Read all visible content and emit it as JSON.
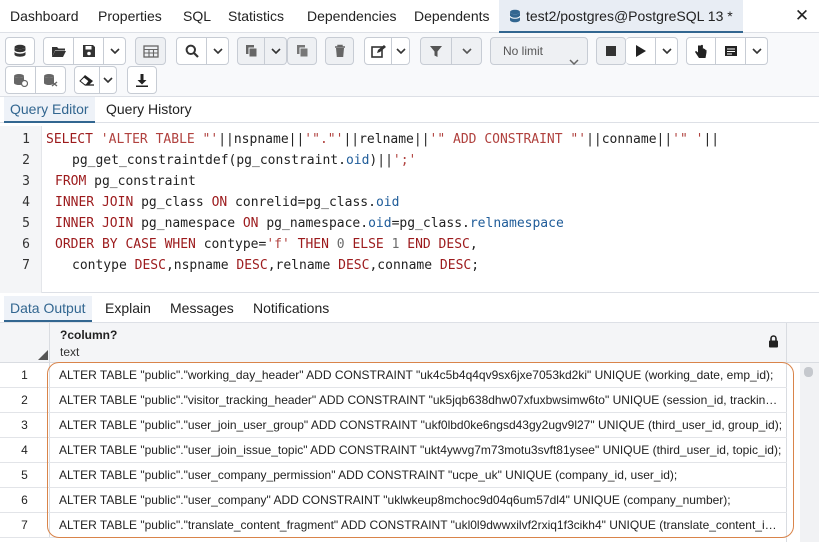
{
  "main_tabs": [
    {
      "label": "Dashboard"
    },
    {
      "label": "Properties"
    },
    {
      "label": "SQL"
    },
    {
      "label": "Statistics"
    },
    {
      "label": "Dependencies"
    },
    {
      "label": "Dependents"
    },
    {
      "label": "test2/postgres@PostgreSQL 13 *"
    }
  ],
  "close_glyph": "✕",
  "toolbar": {
    "limit_label": "No limit"
  },
  "editor_tabs": [
    {
      "label": "Query Editor"
    },
    {
      "label": "Query History"
    }
  ],
  "editor": {
    "line_numbers": [
      "1",
      "2",
      "3",
      "4",
      "5",
      "6",
      "7"
    ]
  },
  "output_tabs": [
    {
      "label": "Data Output"
    },
    {
      "label": "Explain"
    },
    {
      "label": "Messages"
    },
    {
      "label": "Notifications"
    }
  ],
  "grid": {
    "column": {
      "name": "?column?",
      "type": "text"
    },
    "rows": [
      {
        "num": "1",
        "value": "ALTER TABLE \"public\".\"working_day_header\" ADD CONSTRAINT \"uk4c5b4q4qv9sx6jxe7053kd2ki\" UNIQUE (working_date, emp_id);"
      },
      {
        "num": "2",
        "value": "ALTER TABLE \"public\".\"visitor_tracking_header\" ADD CONSTRAINT \"uk5jqb638dhw07xfuxbwsimw6to\" UNIQUE (session_id, tracking_da..."
      },
      {
        "num": "3",
        "value": "ALTER TABLE \"public\".\"user_join_user_group\" ADD CONSTRAINT \"ukf0lbd0ke6ngsd43gy2ugv9l27\" UNIQUE (third_user_id, group_id);"
      },
      {
        "num": "4",
        "value": "ALTER TABLE \"public\".\"user_join_issue_topic\" ADD CONSTRAINT \"ukt4ywvg7m73motu3svft81ysee\" UNIQUE (third_user_id, topic_id);"
      },
      {
        "num": "5",
        "value": "ALTER TABLE \"public\".\"user_company_permission\" ADD CONSTRAINT \"ucpe_uk\" UNIQUE (company_id, user_id);"
      },
      {
        "num": "6",
        "value": "ALTER TABLE \"public\".\"user_company\" ADD CONSTRAINT \"uklwkeup8mchoc9d04q6um57dl4\" UNIQUE (company_number);"
      },
      {
        "num": "7",
        "value": "ALTER TABLE \"public\".\"translate_content_fragment\" ADD CONSTRAINT \"ukl0l9dwwxilvf2rxiq1f3cikh4\" UNIQUE (translate_content_id, co..."
      }
    ]
  },
  "colors": {
    "accent": "#326690",
    "keyword": "#9c1a1c",
    "highlight": "#d9844a"
  }
}
